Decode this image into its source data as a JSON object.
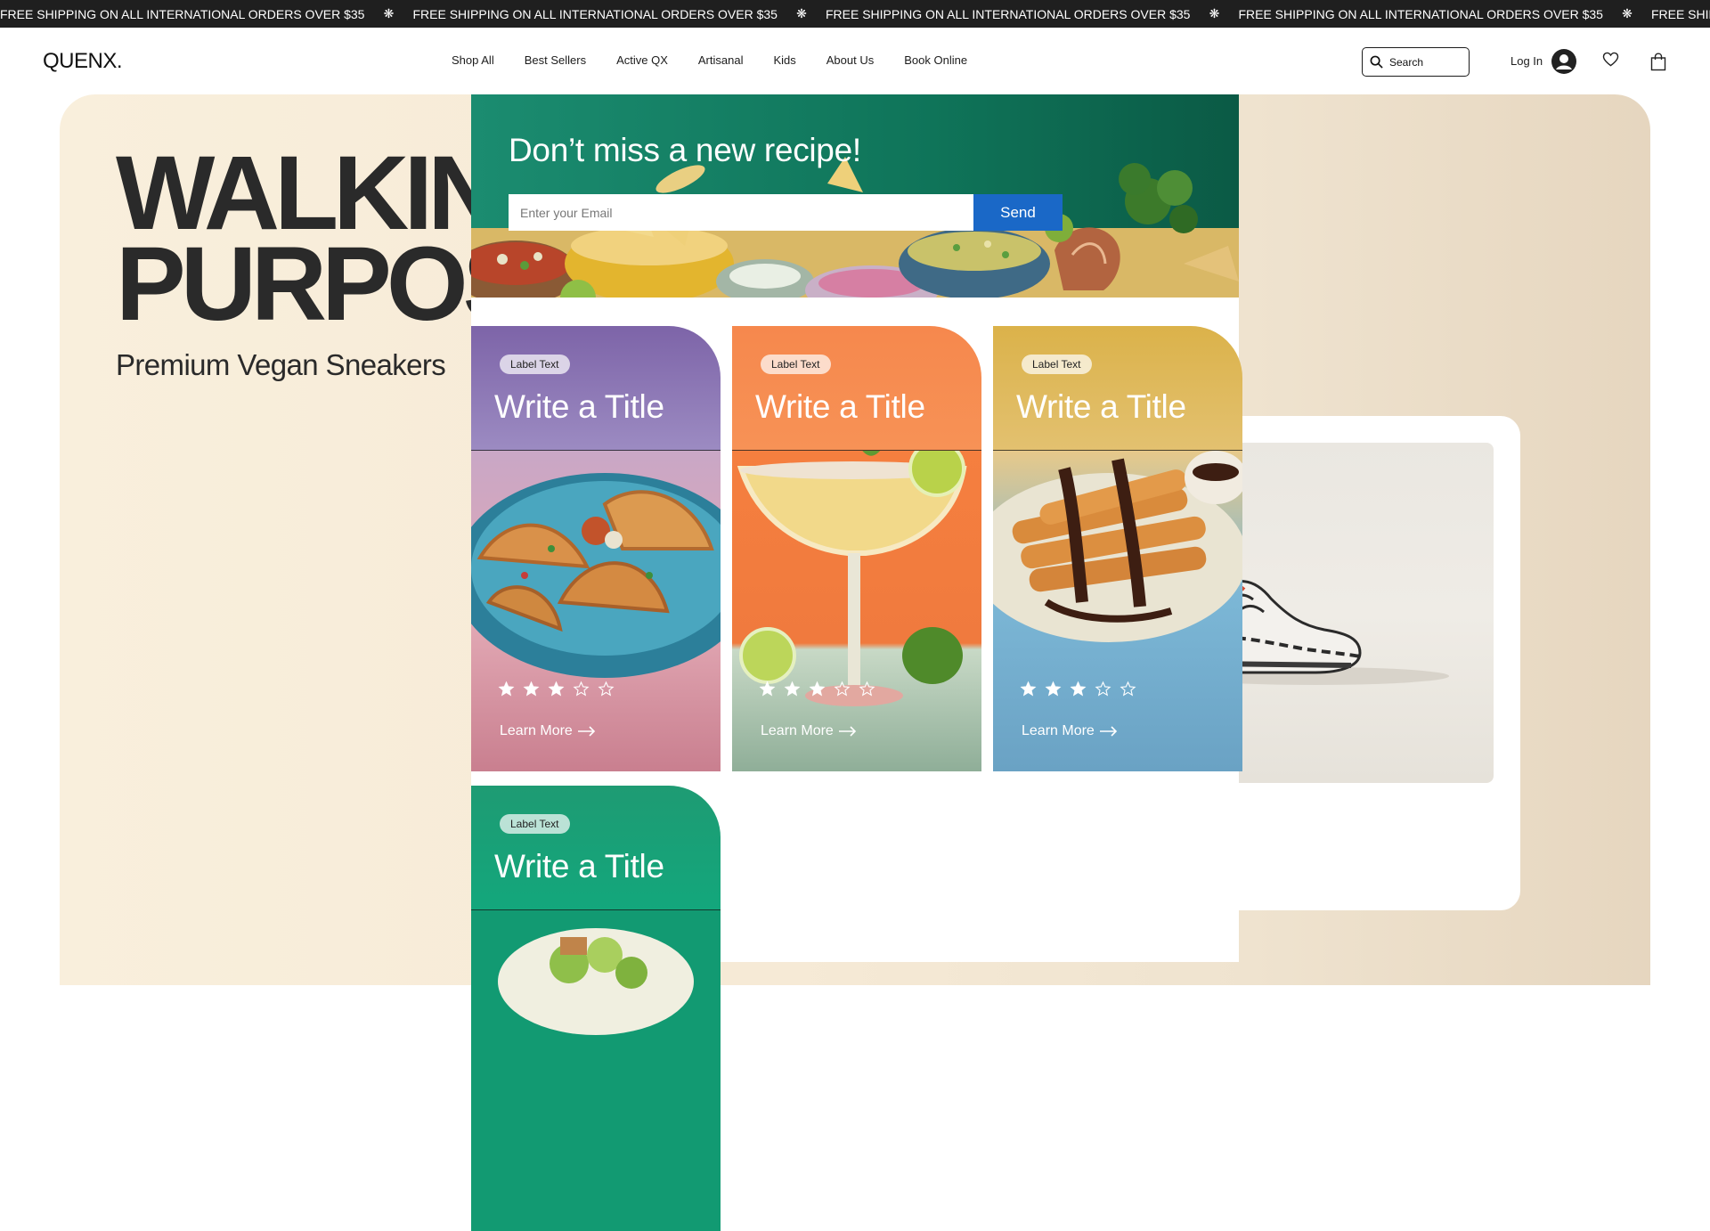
{
  "marquee": {
    "items": [
      "FREE SHIPPING ON ALL INTERNATIONAL ORDERS OVER $35",
      "FREE SHIPPING ON ALL INTERNATIONAL ORDERS OVER $35",
      "FREE SHIPPING ON ALL INTERNATIONAL ORDERS OVER $35",
      "FREE SHIPPING ON ALL INTERNATIONAL ORDERS OVER $35",
      "FREE SHIPPING ON ALL INTERNATIONAL ORDERS OVER"
    ],
    "separator": "❋"
  },
  "header": {
    "logo": "QUENX.",
    "nav": [
      "Shop All",
      "Best Sellers",
      "Active QX",
      "Artisanal",
      "Kids",
      "About Us",
      "Book Online"
    ],
    "search_placeholder": "Search",
    "login": "Log In",
    "icons": {
      "search": "search-icon",
      "account": "avatar-icon",
      "wishlist": "heart-icon",
      "cart": "bag-icon"
    }
  },
  "hero": {
    "title": "WALKIN\nPURPOS",
    "subtitle": "Premium Vegan Sneakers"
  },
  "newsletter": {
    "title": "Don’t miss a new recipe!",
    "email_placeholder": "Enter your Email",
    "send_label": "Send"
  },
  "cards": [
    {
      "label": "Label Text",
      "title": "Write a Title",
      "rating": 3,
      "max_rating": 5,
      "link": "Learn More",
      "theme": "purple"
    },
    {
      "label": "Label Text",
      "title": "Write a Title",
      "rating": 3,
      "max_rating": 5,
      "link": "Learn More",
      "theme": "orange"
    },
    {
      "label": "Label Text",
      "title": "Write a Title",
      "rating": 3,
      "max_rating": 5,
      "link": "Learn More",
      "theme": "gold"
    },
    {
      "label": "Label Text",
      "title": "Write a Title",
      "rating": null,
      "max_rating": 5,
      "link": null,
      "theme": "green"
    }
  ],
  "colors": {
    "marquee_bg": "#1f1f1f",
    "send_button": "#1a68c7",
    "newsletter_green": "#0f7a5f"
  }
}
